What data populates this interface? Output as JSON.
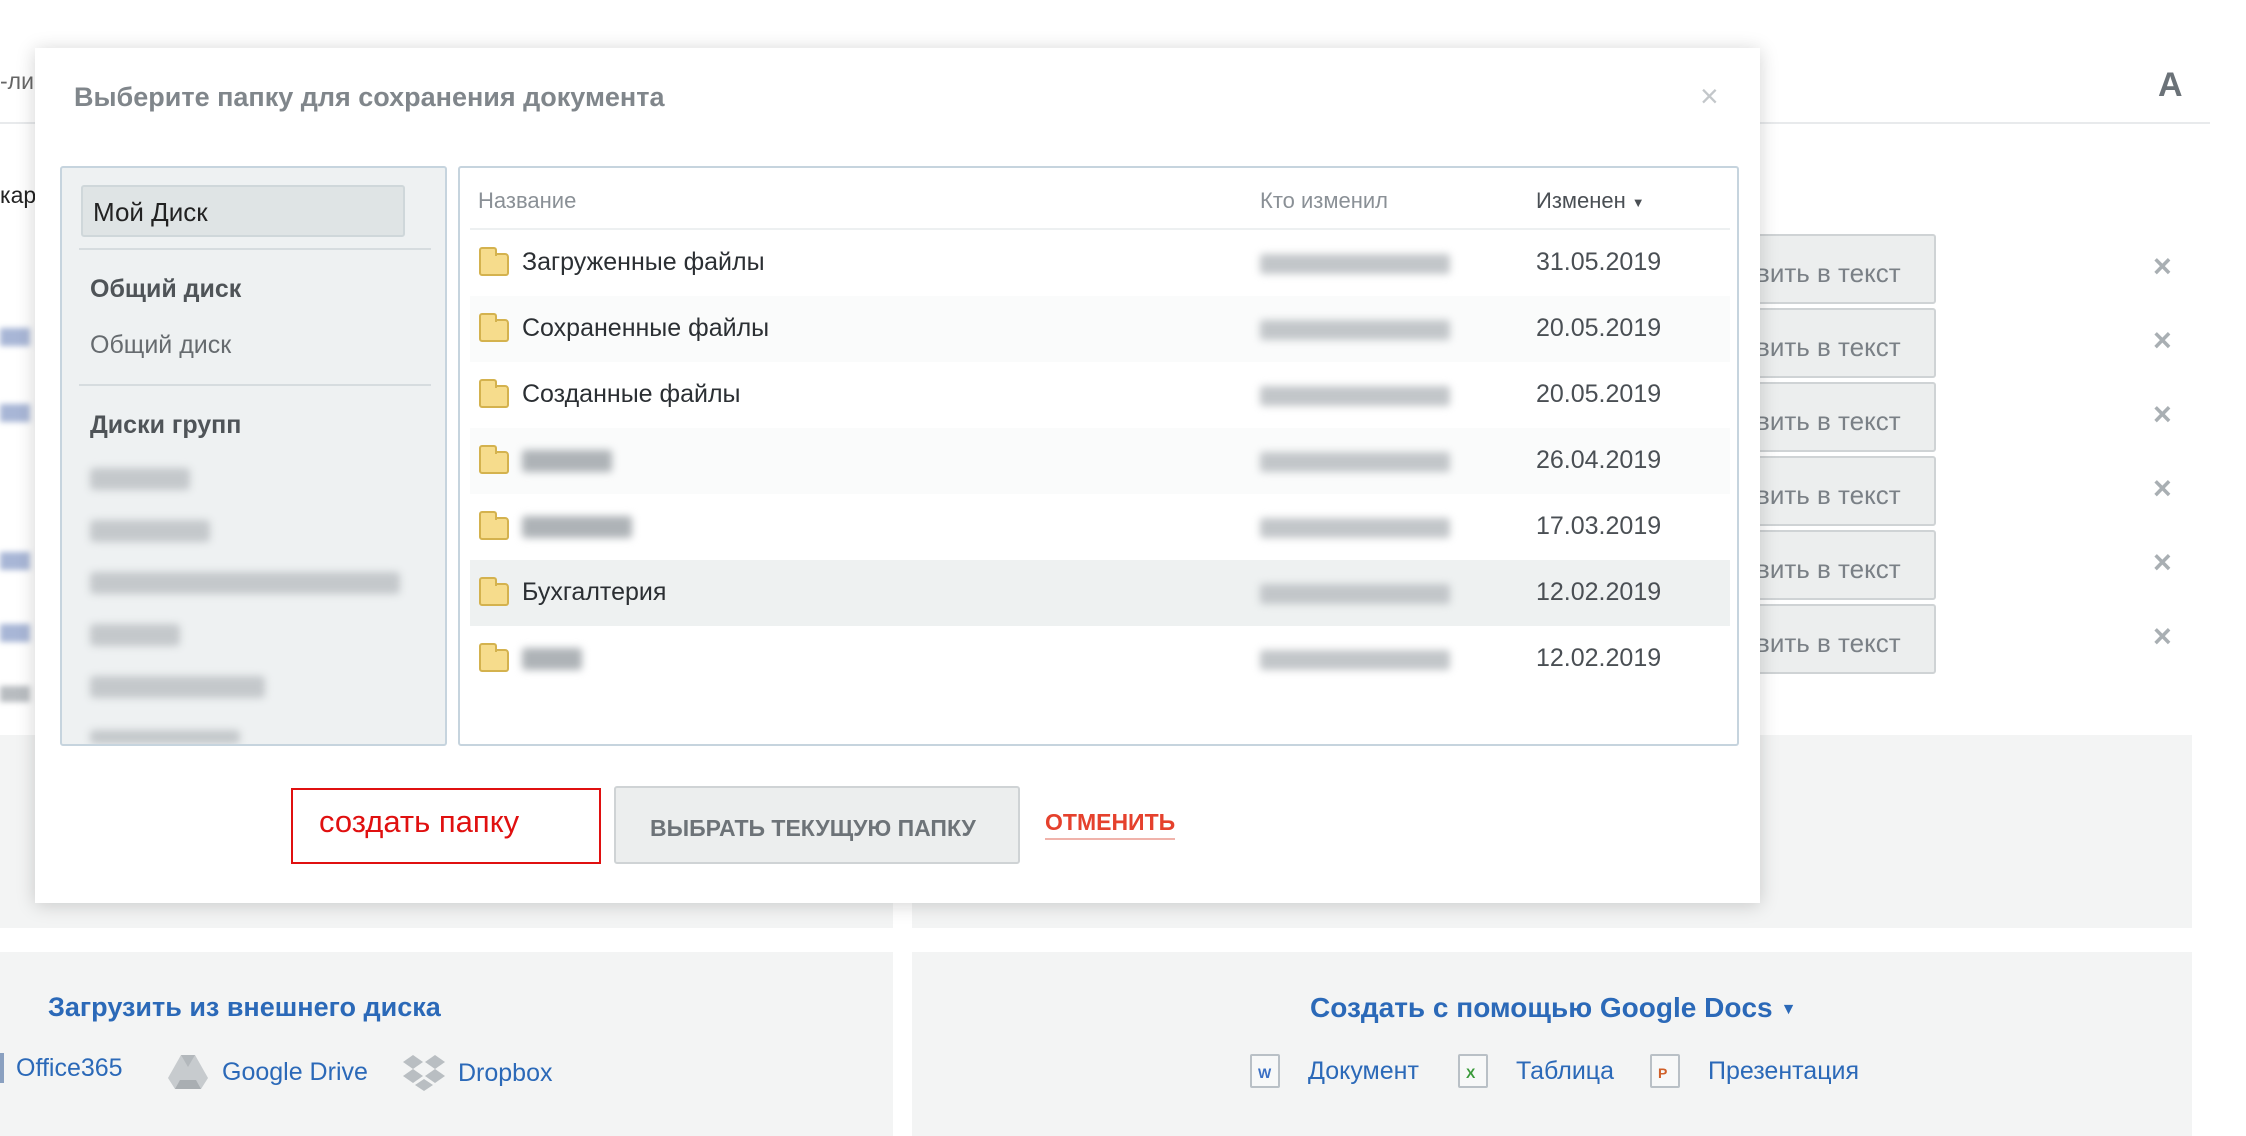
{
  "background": {
    "left_fragments": [
      "-ли",
      "кар"
    ],
    "corner_letter": "A",
    "insert_button_label": "вить в текст",
    "delete_icon": "×",
    "external": {
      "title": "Загрузить из внешнего диска",
      "items": [
        "Office365",
        "Google Drive",
        "Dropbox"
      ]
    },
    "google_docs": {
      "title": "Создать с помощью Google Docs",
      "items": [
        "Документ",
        "Таблица",
        "Презентация"
      ]
    }
  },
  "modal": {
    "title": "Выберите папку для сохранения документа",
    "close": "×",
    "sidebar": {
      "selected": "Мой Диск",
      "shared_heading": "Общий диск",
      "shared_item": "Общий диск",
      "groups_heading": "Диски групп"
    },
    "columns": {
      "name": "Название",
      "who": "Кто изменил",
      "modified": "Изменен"
    },
    "rows": [
      {
        "name": "Загруженные файлы",
        "date": "31.05.2019"
      },
      {
        "name": "Сохраненные файлы",
        "date": "20.05.2019"
      },
      {
        "name": "Созданные файлы",
        "date": "20.05.2019"
      },
      {
        "name": "",
        "date": "26.04.2019"
      },
      {
        "name": "",
        "date": "17.03.2019"
      },
      {
        "name": "Бухгалтерия",
        "date": "12.02.2019"
      },
      {
        "name": "",
        "date": "12.02.2019"
      }
    ],
    "buttons": {
      "create_folder": "создать папку",
      "choose_current": "ВЫБРАТЬ ТЕКУЩУЮ ПАПКУ",
      "cancel": "ОТМЕНИТЬ"
    }
  }
}
